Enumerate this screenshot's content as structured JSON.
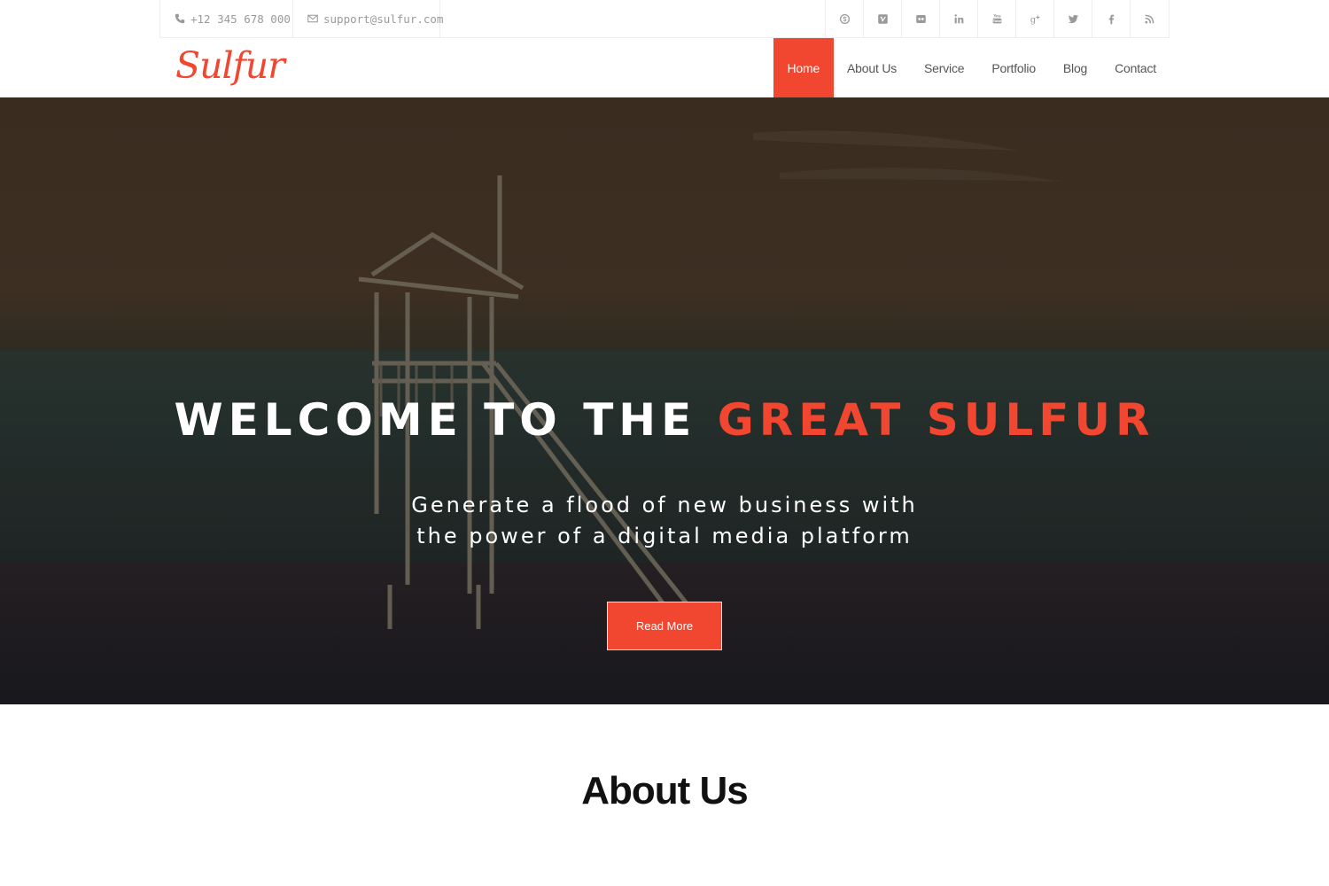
{
  "topbar": {
    "phone": "+12 345 678 000",
    "email": "support@sulfur.com",
    "socials": [
      "skype-icon",
      "vimeo-icon",
      "flickr-icon",
      "linkedin-icon",
      "youtube-icon",
      "google-plus-icon",
      "twitter-icon",
      "facebook-icon",
      "rss-icon"
    ]
  },
  "header": {
    "logo": "Sulfur",
    "nav": [
      {
        "label": "Home",
        "active": true
      },
      {
        "label": "About Us",
        "active": false
      },
      {
        "label": "Service",
        "active": false
      },
      {
        "label": "Portfolio",
        "active": false
      },
      {
        "label": "Blog",
        "active": false
      },
      {
        "label": "Contact",
        "active": false
      }
    ]
  },
  "hero": {
    "title_prefix": "WELCOME TO THE",
    "title_accent": "GREAT SULFUR",
    "subtitle": "Generate a flood of new business with the power of a digital media platform",
    "button": "Read More"
  },
  "about": {
    "title": "About Us"
  },
  "colors": {
    "accent": "#f1462f",
    "icon_gray": "#9a9a9a"
  }
}
